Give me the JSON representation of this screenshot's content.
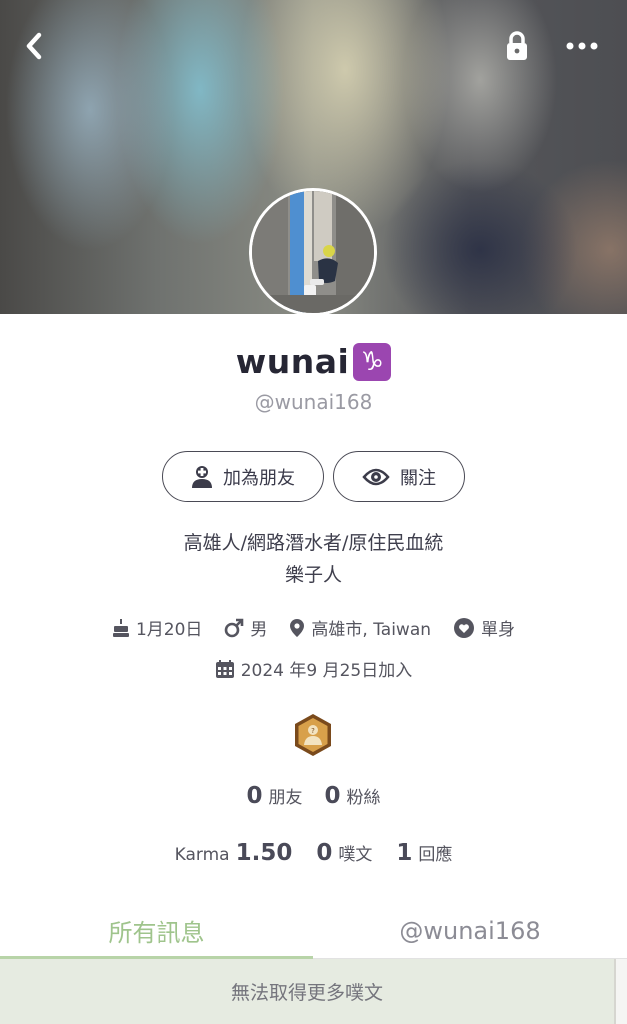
{
  "header": {
    "back_icon": "chevron-left-icon",
    "lock_icon": "lock-icon",
    "more_icon": "more-horizontal-icon"
  },
  "profile": {
    "display_name": "wunai",
    "zodiac_symbol": "♑",
    "zodiac_color": "#9b46b0",
    "handle": "@wunai168",
    "bio_line1": "高雄人/網路潛水者/原住民血統",
    "bio_line2": "樂子人"
  },
  "actions": {
    "add_friend_label": "加為朋友",
    "follow_label": "關注"
  },
  "meta": {
    "birthday": "1月20日",
    "gender": "男",
    "location": "高雄市, Taiwan",
    "relationship": "單身",
    "joined": "2024 年9 月25日加入"
  },
  "stats": {
    "friends_count": "0",
    "friends_label": "朋友",
    "fans_count": "0",
    "fans_label": "粉絲",
    "karma_label": "Karma",
    "karma_value": "1.50",
    "posts_count": "0",
    "posts_label": "噗文",
    "replies_count": "1",
    "replies_label": "回應"
  },
  "tabs": {
    "all_label": "所有訊息",
    "user_label": "@wunai168"
  },
  "feed": {
    "empty_message": "無法取得更多噗文"
  },
  "colors": {
    "accent_green": "#9fc48c",
    "badge_brown": "#7a4a1c",
    "text_dark": "#262634"
  }
}
